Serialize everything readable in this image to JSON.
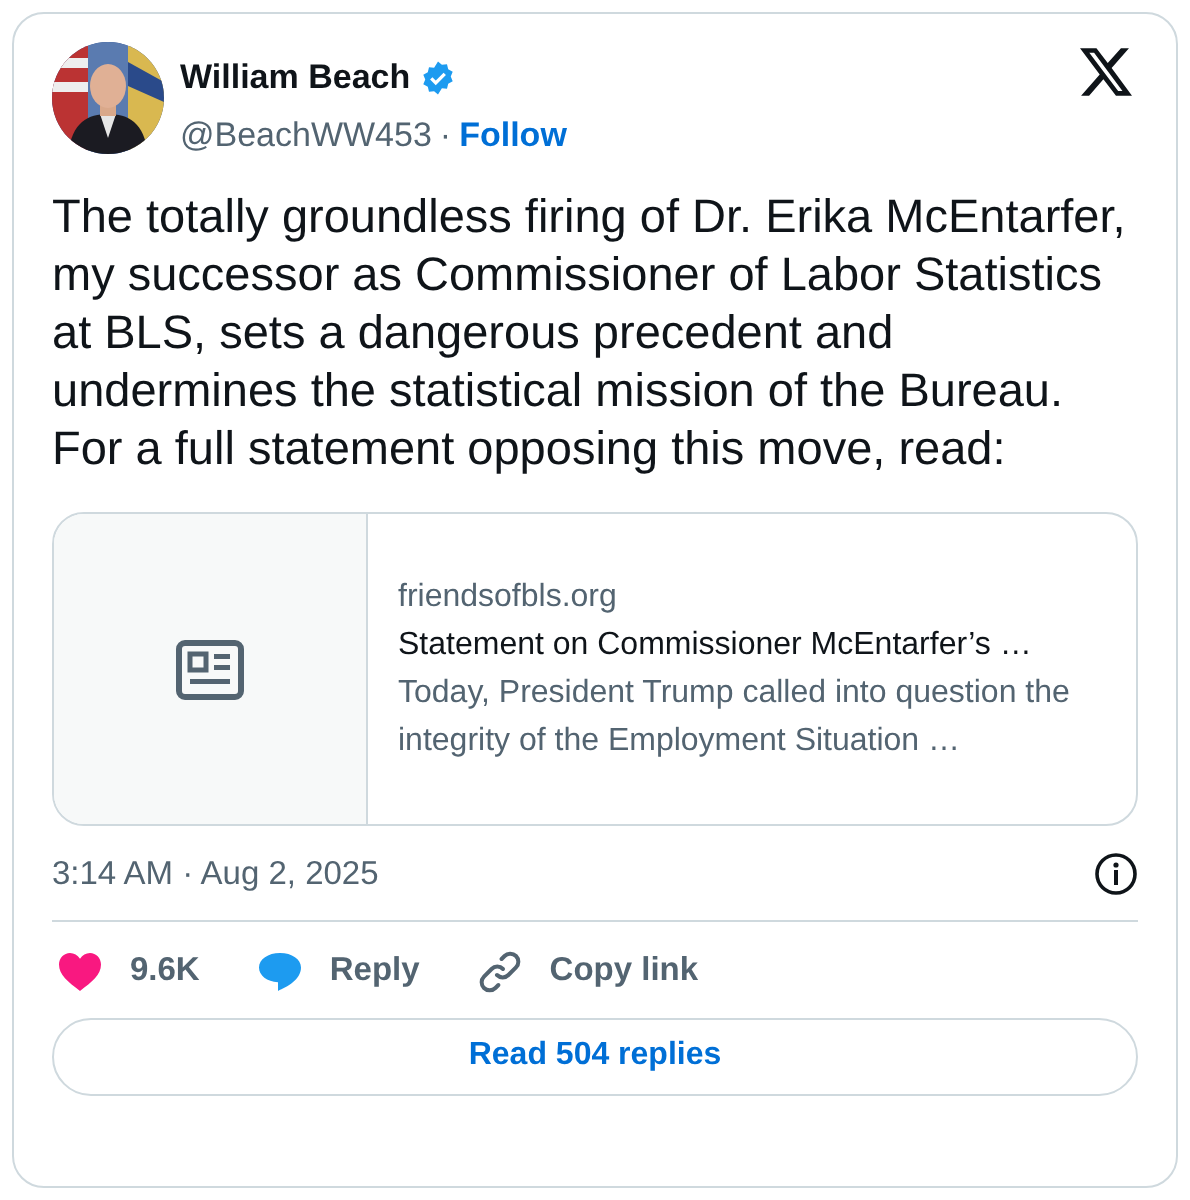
{
  "author": {
    "name": "William Beach",
    "verified": true,
    "handle": "@BeachWW453",
    "separator": "·",
    "follow": "Follow"
  },
  "text": "The totally groundless firing of Dr. Erika McEntarfer, my successor as Commissioner of Labor Statistics at BLS, sets a dangerous precedent and undermines the statistical mission of the Bureau.  For a full statement opposing this move, read:",
  "link_card": {
    "domain": "friendsofbls.org",
    "title": "Statement on Commissioner McEntarfer’s …",
    "description": "Today, President Trump called into question the integrity of the Employment Situation …"
  },
  "timestamp": "3:14 AM · Aug 2, 2025",
  "actions": [
    {
      "kind": "like",
      "label": "9.6K"
    },
    {
      "kind": "reply",
      "label": "Reply"
    },
    {
      "kind": "copy",
      "label": "Copy link"
    }
  ],
  "read_replies": "Read 504 replies"
}
